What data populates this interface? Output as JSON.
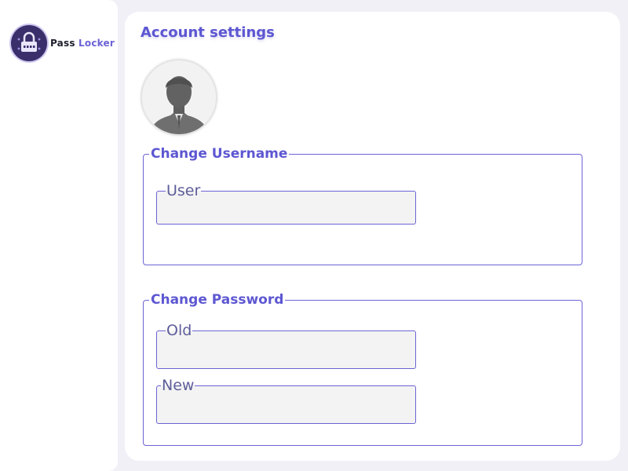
{
  "app": {
    "brand_part1": "Pass",
    "brand_part2": "Locker",
    "accent_color": "#5d57d2"
  },
  "page": {
    "title": "Account settings",
    "avatar_icon": "user-avatar-icon"
  },
  "change_username": {
    "legend": "Change Username",
    "user_label": "User",
    "user_value": ""
  },
  "change_password": {
    "legend": "Change Password",
    "old_label": "Old",
    "old_value": "",
    "new_label": "New",
    "new_value": ""
  }
}
